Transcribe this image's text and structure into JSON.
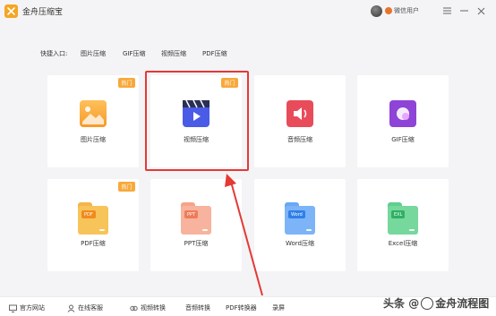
{
  "app": {
    "title": "金舟压缩宝",
    "username": "微信用户"
  },
  "quick_entry": {
    "label": "快捷入口:",
    "links": [
      "图片压缩",
      "GIF压缩",
      "视频压缩",
      "PDF压缩"
    ]
  },
  "hot_label": "热门",
  "tools_row1": [
    {
      "label": "图片压缩",
      "hot": true,
      "icon": "image-icon",
      "color": "#f7a93b"
    },
    {
      "label": "视频压缩",
      "hot": true,
      "icon": "video-clapper-icon",
      "color": "#4a5be8"
    },
    {
      "label": "音频压缩",
      "hot": false,
      "icon": "audio-icon",
      "color": "#e84c5a"
    },
    {
      "label": "GIF压缩",
      "hot": false,
      "icon": "gif-icon",
      "color": "#8e44d6"
    }
  ],
  "tools_row2": [
    {
      "label": "PDF压缩",
      "hot": true,
      "icon": "pdf-file-icon",
      "color": "#f7a93b",
      "tag": "PDF"
    },
    {
      "label": "PPT压缩",
      "hot": false,
      "icon": "ppt-file-icon",
      "color": "#f39478",
      "tag": "PPT"
    },
    {
      "label": "Word压缩",
      "hot": false,
      "icon": "word-file-icon",
      "color": "#3d8ef0",
      "tag": "Word"
    },
    {
      "label": "Excel压缩",
      "hot": false,
      "icon": "excel-file-icon",
      "color": "#3cc172",
      "tag": "EXL"
    }
  ],
  "footer": {
    "website": "官方网站",
    "support": "在线客服",
    "video_convert": "视频转换",
    "audio_convert": "音频转换",
    "pdf_convert": "PDF转换器",
    "record": "录屏"
  },
  "watermark": {
    "prefix": "头条",
    "at": "@",
    "name": "金舟流程图"
  },
  "colors": {
    "accent": "#f7a93b",
    "highlight": "#e53935",
    "background": "#f4f4f6"
  }
}
